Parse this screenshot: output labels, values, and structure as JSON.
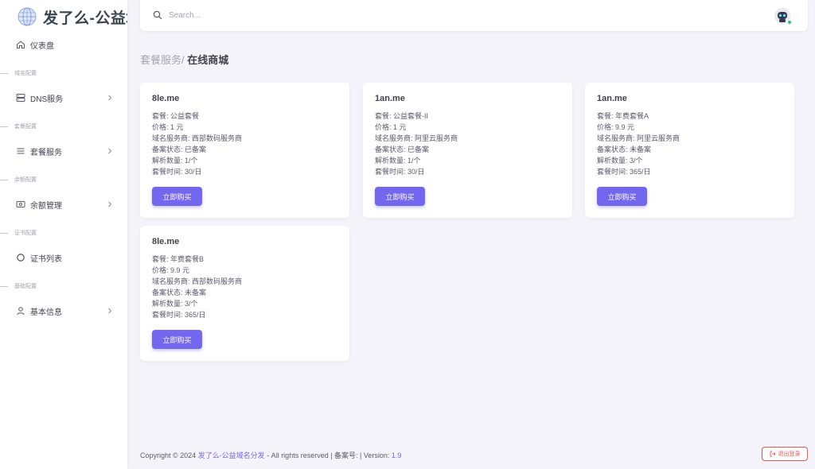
{
  "brand": {
    "title": "发了么-公益域"
  },
  "sidebar": {
    "dashboard": "仪表盘",
    "sections": [
      "域名配置",
      "套餐配置",
      "余额配置",
      "证书配置",
      "基础配置"
    ],
    "items": [
      {
        "label": "DNS服务",
        "icon": "server-icon"
      },
      {
        "label": "套餐服务",
        "icon": "list-icon"
      },
      {
        "label": "余额管理",
        "icon": "wallet-icon"
      },
      {
        "label": "证书列表",
        "icon": "circle-icon"
      },
      {
        "label": "基本信息",
        "icon": "user-icon"
      }
    ]
  },
  "search": {
    "placeholder": "Search..."
  },
  "breadcrumb": {
    "parent": "套餐服务/",
    "current": "在线商城"
  },
  "cards": [
    {
      "domain": "8le.me",
      "package": "套餐:  公益套餐",
      "price": "价格:  1 元",
      "provider": "域名服务商:  西部数码服务商",
      "icp": "备案状态:  已备案",
      "records": "解析数量:  1/个",
      "duration": "套餐时间:  30/日",
      "button": "立即购买"
    },
    {
      "domain": "1an.me",
      "package": "套餐:  公益套餐-II",
      "price": "价格:  1 元",
      "provider": "域名服务商:  阿里云服务商",
      "icp": "备案状态:  已备案",
      "records": "解析数量:  1/个",
      "duration": "套餐时间:  30/日",
      "button": "立即购买"
    },
    {
      "domain": "1an.me",
      "package": "套餐:  年费套餐A",
      "price": "价格:  9.9 元",
      "provider": "域名服务商:  阿里云服务商",
      "icp": "备案状态:  未备案",
      "records": "解析数量:  3/个",
      "duration": "套餐时间:  365/日",
      "button": "立即购买"
    },
    {
      "domain": "8le.me",
      "package": "套餐:  年费套餐B",
      "price": "价格:  9.9 元",
      "provider": "域名服务商:  西部数码服务商",
      "icp": "备案状态:  未备案",
      "records": "解析数量:  3/个",
      "duration": "套餐时间:  365/日",
      "button": "立即购买"
    }
  ],
  "footer": {
    "copyright": "Copyright © 2024 ",
    "site_link": "发了么-公益域名分发",
    "rights": " - All rights reserved | 备案号:  | Version: ",
    "version": "1.9"
  },
  "logout": {
    "label": "退出登录"
  },
  "colors": {
    "accent": "#7367f0",
    "danger": "#ea5455",
    "online": "#28c76f"
  }
}
